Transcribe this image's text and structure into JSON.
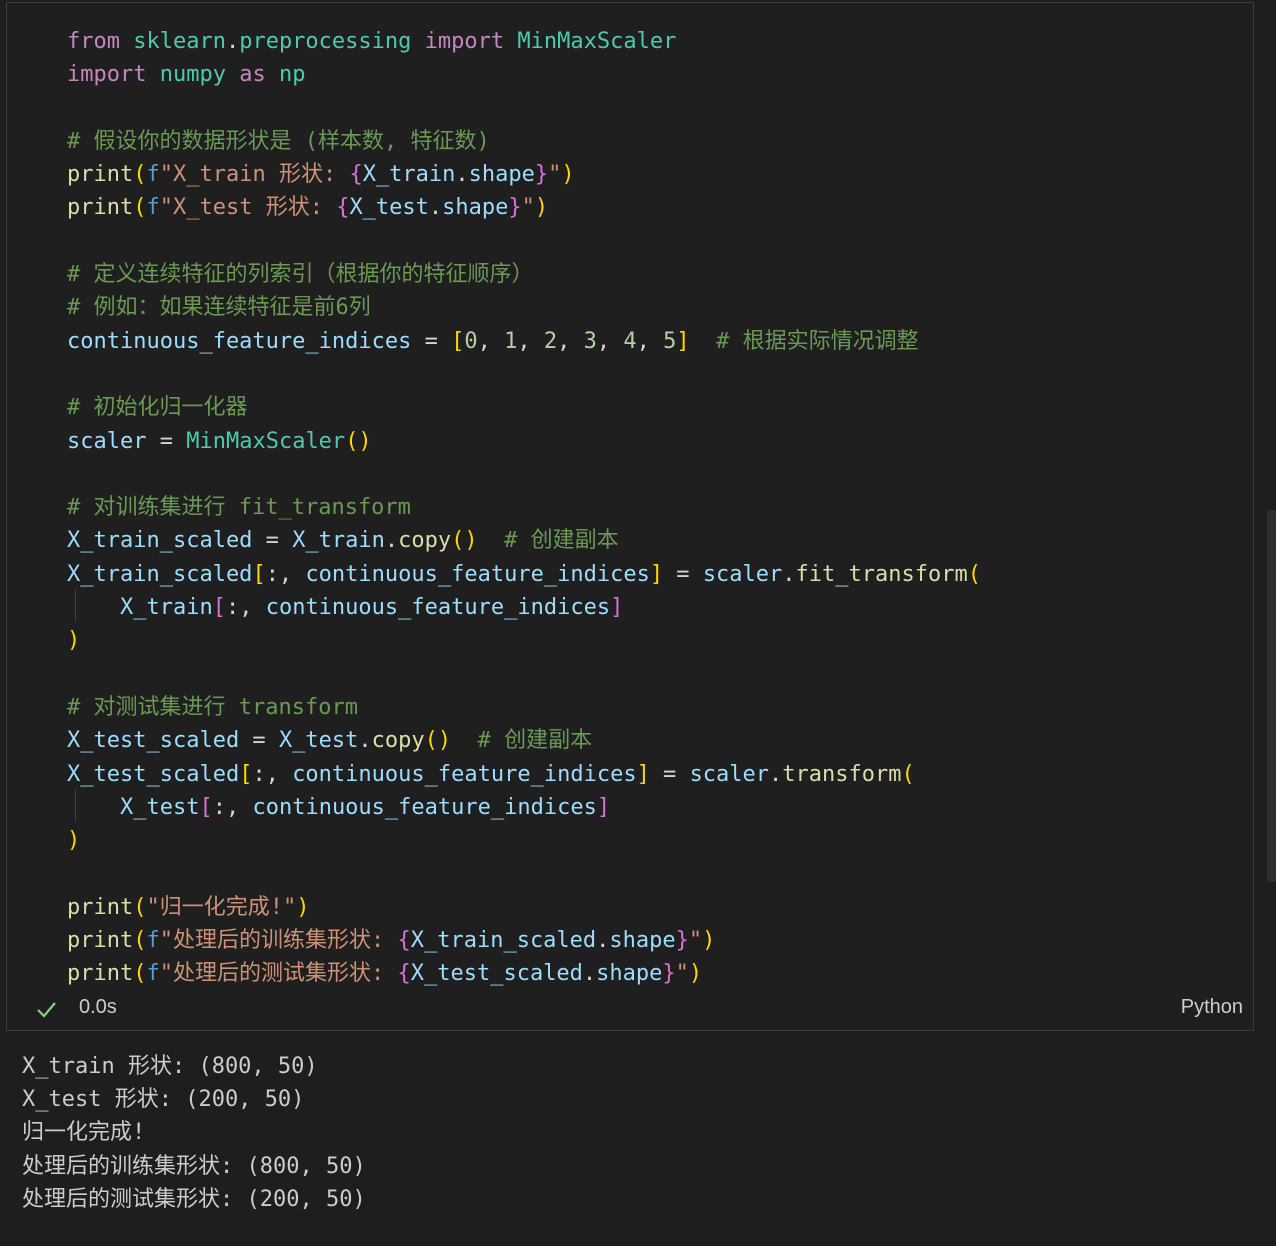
{
  "cell": {
    "status": {
      "time": "0.0s",
      "language": "Python",
      "state_icon": "check-icon",
      "success_color": "#89d185"
    },
    "code_lines": [
      [
        {
          "t": "from",
          "c": "kw"
        },
        {
          "t": " ",
          "c": "pl"
        },
        {
          "t": "sklearn",
          "c": "mod"
        },
        {
          "t": ".",
          "c": "pl"
        },
        {
          "t": "preprocessing",
          "c": "mod"
        },
        {
          "t": " ",
          "c": "pl"
        },
        {
          "t": "import",
          "c": "kw"
        },
        {
          "t": " ",
          "c": "pl"
        },
        {
          "t": "MinMaxScaler",
          "c": "cls"
        }
      ],
      [
        {
          "t": "import",
          "c": "kw"
        },
        {
          "t": " ",
          "c": "pl"
        },
        {
          "t": "numpy",
          "c": "mod"
        },
        {
          "t": " ",
          "c": "pl"
        },
        {
          "t": "as",
          "c": "kw"
        },
        {
          "t": " ",
          "c": "pl"
        },
        {
          "t": "np",
          "c": "mod"
        }
      ],
      [],
      [
        {
          "t": "# 假设你的数据形状是 (样本数, 特征数)",
          "c": "cm"
        }
      ],
      [
        {
          "t": "print",
          "c": "fn"
        },
        {
          "t": "(",
          "c": "p1"
        },
        {
          "t": "f",
          "c": "fk"
        },
        {
          "t": "\"X_train 形状: ",
          "c": "str"
        },
        {
          "t": "{",
          "c": "p2"
        },
        {
          "t": "X_train",
          "c": "var"
        },
        {
          "t": ".",
          "c": "pl"
        },
        {
          "t": "shape",
          "c": "var"
        },
        {
          "t": "}",
          "c": "p2"
        },
        {
          "t": "\"",
          "c": "str"
        },
        {
          "t": ")",
          "c": "p1"
        }
      ],
      [
        {
          "t": "print",
          "c": "fn"
        },
        {
          "t": "(",
          "c": "p1"
        },
        {
          "t": "f",
          "c": "fk"
        },
        {
          "t": "\"X_test 形状: ",
          "c": "str"
        },
        {
          "t": "{",
          "c": "p2"
        },
        {
          "t": "X_test",
          "c": "var"
        },
        {
          "t": ".",
          "c": "pl"
        },
        {
          "t": "shape",
          "c": "var"
        },
        {
          "t": "}",
          "c": "p2"
        },
        {
          "t": "\"",
          "c": "str"
        },
        {
          "t": ")",
          "c": "p1"
        }
      ],
      [],
      [
        {
          "t": "# 定义连续特征的列索引（根据你的特征顺序）",
          "c": "cm"
        }
      ],
      [
        {
          "t": "# 例如：如果连续特征是前6列",
          "c": "cm"
        }
      ],
      [
        {
          "t": "continuous_feature_indices",
          "c": "var"
        },
        {
          "t": " = ",
          "c": "pl"
        },
        {
          "t": "[",
          "c": "p1"
        },
        {
          "t": "0",
          "c": "num"
        },
        {
          "t": ", ",
          "c": "pl"
        },
        {
          "t": "1",
          "c": "num"
        },
        {
          "t": ", ",
          "c": "pl"
        },
        {
          "t": "2",
          "c": "num"
        },
        {
          "t": ", ",
          "c": "pl"
        },
        {
          "t": "3",
          "c": "num"
        },
        {
          "t": ", ",
          "c": "pl"
        },
        {
          "t": "4",
          "c": "num"
        },
        {
          "t": ", ",
          "c": "pl"
        },
        {
          "t": "5",
          "c": "num"
        },
        {
          "t": "]",
          "c": "p1"
        },
        {
          "t": "  ",
          "c": "pl"
        },
        {
          "t": "# 根据实际情况调整",
          "c": "cm"
        }
      ],
      [],
      [
        {
          "t": "# 初始化归一化器",
          "c": "cm"
        }
      ],
      [
        {
          "t": "scaler",
          "c": "var"
        },
        {
          "t": " = ",
          "c": "pl"
        },
        {
          "t": "MinMaxScaler",
          "c": "cls"
        },
        {
          "t": "()",
          "c": "p1"
        }
      ],
      [],
      [
        {
          "t": "# 对训练集进行 fit_transform",
          "c": "cm"
        }
      ],
      [
        {
          "t": "X_train_scaled",
          "c": "var"
        },
        {
          "t": " = ",
          "c": "pl"
        },
        {
          "t": "X_train",
          "c": "var"
        },
        {
          "t": ".",
          "c": "pl"
        },
        {
          "t": "copy",
          "c": "fn"
        },
        {
          "t": "()",
          "c": "p1"
        },
        {
          "t": "  ",
          "c": "pl"
        },
        {
          "t": "# 创建副本",
          "c": "cm"
        }
      ],
      [
        {
          "t": "X_train_scaled",
          "c": "var"
        },
        {
          "t": "[",
          "c": "p1"
        },
        {
          "t": ":, ",
          "c": "pl"
        },
        {
          "t": "continuous_feature_indices",
          "c": "var"
        },
        {
          "t": "]",
          "c": "p1"
        },
        {
          "t": " = ",
          "c": "pl"
        },
        {
          "t": "scaler",
          "c": "var"
        },
        {
          "t": ".",
          "c": "pl"
        },
        {
          "t": "fit_transform",
          "c": "fn"
        },
        {
          "t": "(",
          "c": "p1"
        }
      ],
      [
        {
          "t": "    ",
          "c": "pl"
        },
        {
          "t": "X_train",
          "c": "var"
        },
        {
          "t": "[",
          "c": "p2"
        },
        {
          "t": ":, ",
          "c": "pl"
        },
        {
          "t": "continuous_feature_indices",
          "c": "var"
        },
        {
          "t": "]",
          "c": "p2"
        }
      ],
      [
        {
          "t": ")",
          "c": "p1"
        }
      ],
      [],
      [
        {
          "t": "# 对测试集进行 transform",
          "c": "cm"
        }
      ],
      [
        {
          "t": "X_test_scaled",
          "c": "var"
        },
        {
          "t": " = ",
          "c": "pl"
        },
        {
          "t": "X_test",
          "c": "var"
        },
        {
          "t": ".",
          "c": "pl"
        },
        {
          "t": "copy",
          "c": "fn"
        },
        {
          "t": "()",
          "c": "p1"
        },
        {
          "t": "  ",
          "c": "pl"
        },
        {
          "t": "# 创建副本",
          "c": "cm"
        }
      ],
      [
        {
          "t": "X_test_scaled",
          "c": "var"
        },
        {
          "t": "[",
          "c": "p1"
        },
        {
          "t": ":, ",
          "c": "pl"
        },
        {
          "t": "continuous_feature_indices",
          "c": "var"
        },
        {
          "t": "]",
          "c": "p1"
        },
        {
          "t": " = ",
          "c": "pl"
        },
        {
          "t": "scaler",
          "c": "var"
        },
        {
          "t": ".",
          "c": "pl"
        },
        {
          "t": "transform",
          "c": "fn"
        },
        {
          "t": "(",
          "c": "p1"
        }
      ],
      [
        {
          "t": "    ",
          "c": "pl"
        },
        {
          "t": "X_test",
          "c": "var"
        },
        {
          "t": "[",
          "c": "p2"
        },
        {
          "t": ":, ",
          "c": "pl"
        },
        {
          "t": "continuous_feature_indices",
          "c": "var"
        },
        {
          "t": "]",
          "c": "p2"
        }
      ],
      [
        {
          "t": ")",
          "c": "p1"
        }
      ],
      [],
      [
        {
          "t": "print",
          "c": "fn"
        },
        {
          "t": "(",
          "c": "p1"
        },
        {
          "t": "\"归一化完成!\"",
          "c": "str"
        },
        {
          "t": ")",
          "c": "p1"
        }
      ],
      [
        {
          "t": "print",
          "c": "fn"
        },
        {
          "t": "(",
          "c": "p1"
        },
        {
          "t": "f",
          "c": "fk"
        },
        {
          "t": "\"处理后的训练集形状: ",
          "c": "str"
        },
        {
          "t": "{",
          "c": "p2"
        },
        {
          "t": "X_train_scaled",
          "c": "var"
        },
        {
          "t": ".",
          "c": "pl"
        },
        {
          "t": "shape",
          "c": "var"
        },
        {
          "t": "}",
          "c": "p2"
        },
        {
          "t": "\"",
          "c": "str"
        },
        {
          "t": ")",
          "c": "p1"
        }
      ],
      [
        {
          "t": "print",
          "c": "fn"
        },
        {
          "t": "(",
          "c": "p1"
        },
        {
          "t": "f",
          "c": "fk"
        },
        {
          "t": "\"处理后的测试集形状: ",
          "c": "str"
        },
        {
          "t": "{",
          "c": "p2"
        },
        {
          "t": "X_test_scaled",
          "c": "var"
        },
        {
          "t": ".",
          "c": "pl"
        },
        {
          "t": "shape",
          "c": "var"
        },
        {
          "t": "}",
          "c": "p2"
        },
        {
          "t": "\"",
          "c": "str"
        },
        {
          "t": ")",
          "c": "p1"
        }
      ]
    ]
  },
  "output": {
    "lines": [
      "X_train 形状: (800, 50)",
      "X_test 形状: (200, 50)",
      "归一化完成!",
      "处理后的训练集形状: (800, 50)",
      "处理后的测试集形状: (200, 50)"
    ]
  }
}
